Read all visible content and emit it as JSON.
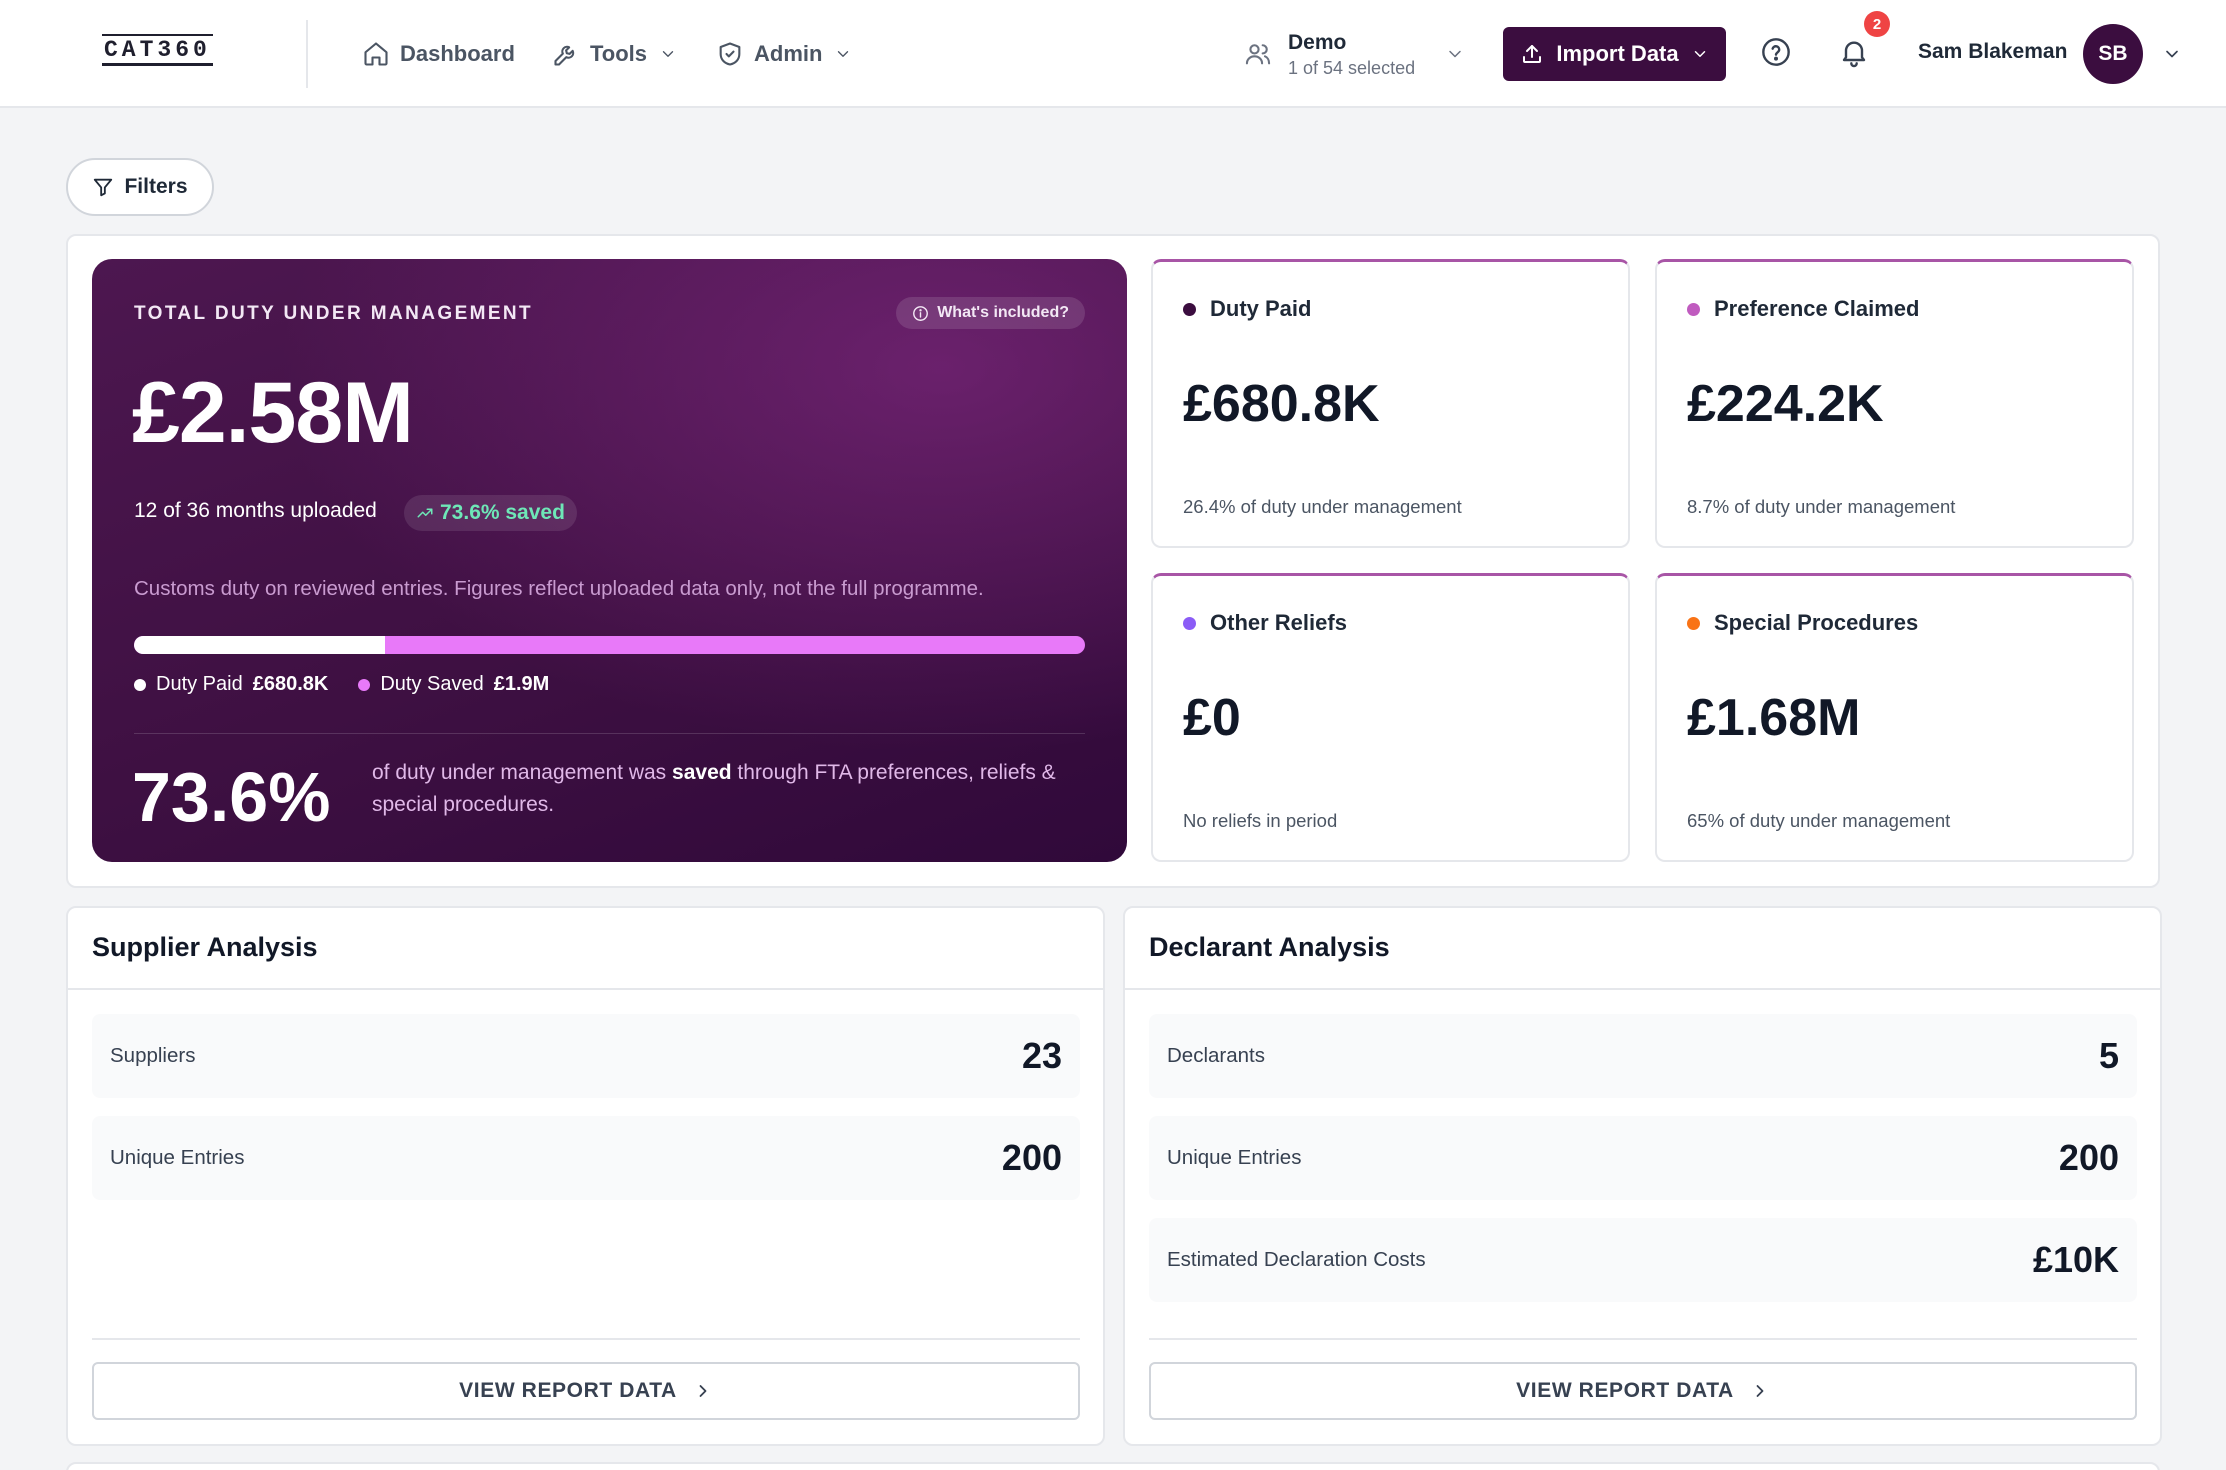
{
  "nav": {
    "logo": "CAT360",
    "items": [
      {
        "label": "Dashboard",
        "icon": "home-icon"
      },
      {
        "label": "Tools",
        "icon": "wrench-icon"
      },
      {
        "label": "Admin",
        "icon": "shield-icon"
      }
    ],
    "workspace": {
      "name": "Demo",
      "sub": "1 of 54 selected"
    },
    "import_label": "Import Data",
    "notification_count": "2",
    "user_name": "Sam Blakeman",
    "user_initials": "SB"
  },
  "filters_label": "Filters",
  "hero": {
    "label": "TOTAL DUTY UNDER MANAGEMENT",
    "whats_included": "What's included?",
    "total": "£2.58M",
    "months": "12 of 36 months uploaded",
    "saved_badge": "73.6% saved",
    "description": "Customs duty on reviewed entries. Figures reflect uploaded data only, not the full programme.",
    "paid_share": 0.264,
    "legend": [
      {
        "label": "Duty Paid",
        "value": "£680.8K",
        "color": "#ffffff"
      },
      {
        "label": "Duty Saved",
        "value": "£1.9M",
        "color": "#e879f9"
      }
    ],
    "pct": "73.6%",
    "pct_text_a": "of duty under management was",
    "pct_text_bold": "saved",
    "pct_text_b": "through FTA preferences, reliefs & special procedures."
  },
  "metrics": [
    {
      "title": "Duty Paid",
      "value": "£680.8K",
      "sub": "26.4% of duty under management",
      "color": "#3b0d3f"
    },
    {
      "title": "Preference Claimed",
      "value": "£224.2K",
      "sub": "8.7% of duty under management",
      "color": "#c05bbf"
    },
    {
      "title": "Other Reliefs",
      "value": "£0",
      "sub": "No reliefs in period",
      "color": "#8b5cf6"
    },
    {
      "title": "Special Procedures",
      "value": "£1.68M",
      "sub": "65% of duty under management",
      "color": "#f97316"
    }
  ],
  "supplier": {
    "title": "Supplier Analysis",
    "rows": [
      {
        "label": "Suppliers",
        "value": "23"
      },
      {
        "label": "Unique Entries",
        "value": "200"
      }
    ],
    "button": "VIEW REPORT DATA"
  },
  "declarant": {
    "title": "Declarant Analysis",
    "rows": [
      {
        "label": "Declarants",
        "value": "5"
      },
      {
        "label": "Unique Entries",
        "value": "200"
      },
      {
        "label": "Estimated Declaration Costs",
        "value": "£10K"
      }
    ],
    "button": "VIEW REPORT DATA"
  }
}
